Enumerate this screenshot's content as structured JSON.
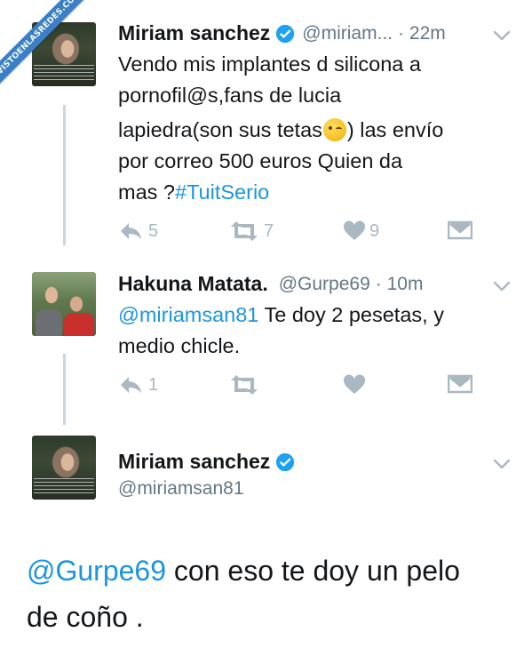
{
  "watermark": "VISTOENLASREDES.COM",
  "colors": {
    "link": "#1b95e0",
    "secondary": "#657786",
    "action": "#aab8c2",
    "verified": "#1da1f2",
    "ribbon": "#3b80c6"
  },
  "tweets": [
    {
      "name": "Miriam sanchez",
      "handle": "@miriam...",
      "time": "· 22m",
      "verified": true,
      "text_lines": [
        "Vendo mis implantes d silicona a",
        "pornofil@s,fans de lucia",
        "lapiedra(son sus tetas",
        ") las envío",
        "por correo 500 euros Quien da",
        "mas ?"
      ],
      "hashtag": "#TuitSerio",
      "emoji": "winking-face",
      "reply_count": "5",
      "retweet_count": "7",
      "like_count": "9"
    },
    {
      "name": "Hakuna Matata.",
      "handle": "@Gurpe69",
      "time": "· 10m",
      "mention": "@miriamsan81",
      "text_lines": [
        " Te doy 2 pesetas, y",
        "medio chicle."
      ],
      "reply_count": "1",
      "retweet_count": "",
      "like_count": ""
    },
    {
      "name": "Miriam sanchez",
      "handle": "@miriamsan81",
      "verified": true,
      "mention": "@Gurpe69",
      "text_lines": [
        " con eso te doy un pelo",
        "de coño ."
      ]
    }
  ]
}
